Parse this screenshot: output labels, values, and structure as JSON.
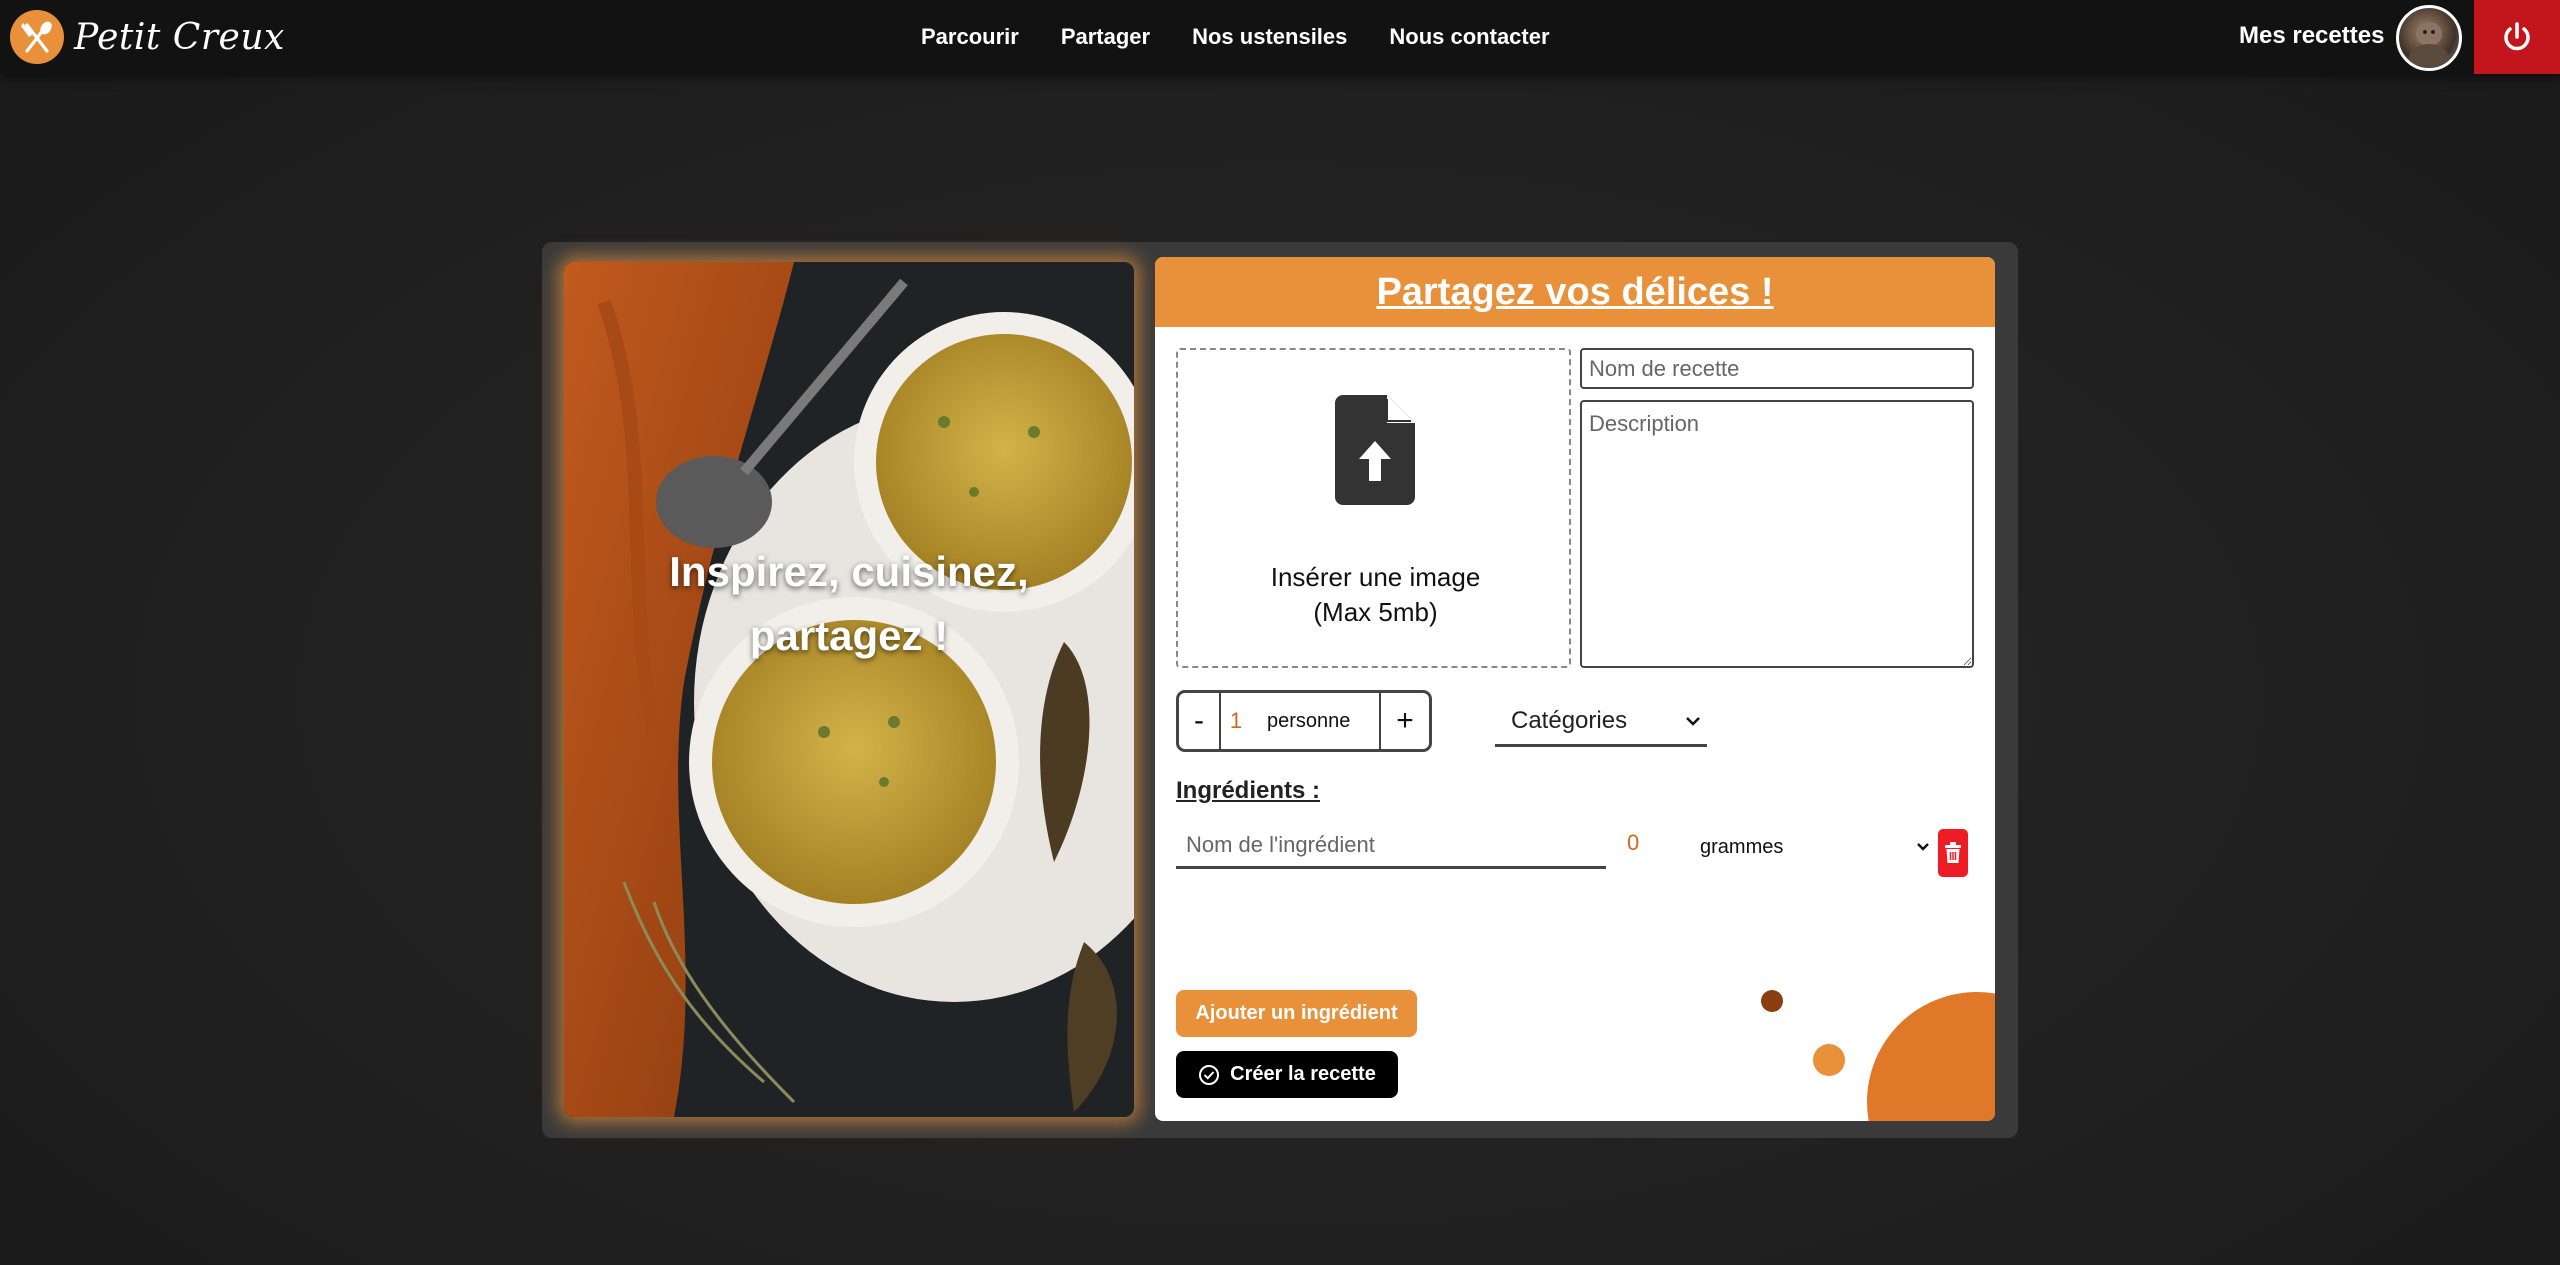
{
  "navbar": {
    "brand_name": "Petit Creux",
    "links": [
      "Parcourir",
      "Partager",
      "Nos ustensiles",
      "Nous contacter"
    ],
    "my_recipes": "Mes recettes",
    "icons": {
      "logo": "fork-knife-icon",
      "logout": "power-icon"
    }
  },
  "hero": {
    "line1": "Inspirez, cuisinez,",
    "line2": "partagez !"
  },
  "form": {
    "title": "Partagez vos délices !",
    "upload": {
      "line1": "Insérer une image",
      "line2": "(Max 5mb)",
      "icon": "file-upload-icon"
    },
    "recipe_name_placeholder": "Nom de recette",
    "description_placeholder": "Description",
    "servings": {
      "minus": "-",
      "value": "1",
      "unit": "personne",
      "plus": "+"
    },
    "categories_label": "Catégories",
    "ingredients_title": "Ingrédients :",
    "ingredient": {
      "name_placeholder": "Nom de l'ingrédient",
      "quantity": "0",
      "unit": "grammes"
    },
    "add_ingredient": "Ajouter un ingrédient",
    "create_recipe": "Créer la recette"
  },
  "colors": {
    "accent": "#e8913a",
    "danger": "#ee1c25",
    "logout_bg": "#c3161c",
    "nav_bg": "#121212"
  }
}
